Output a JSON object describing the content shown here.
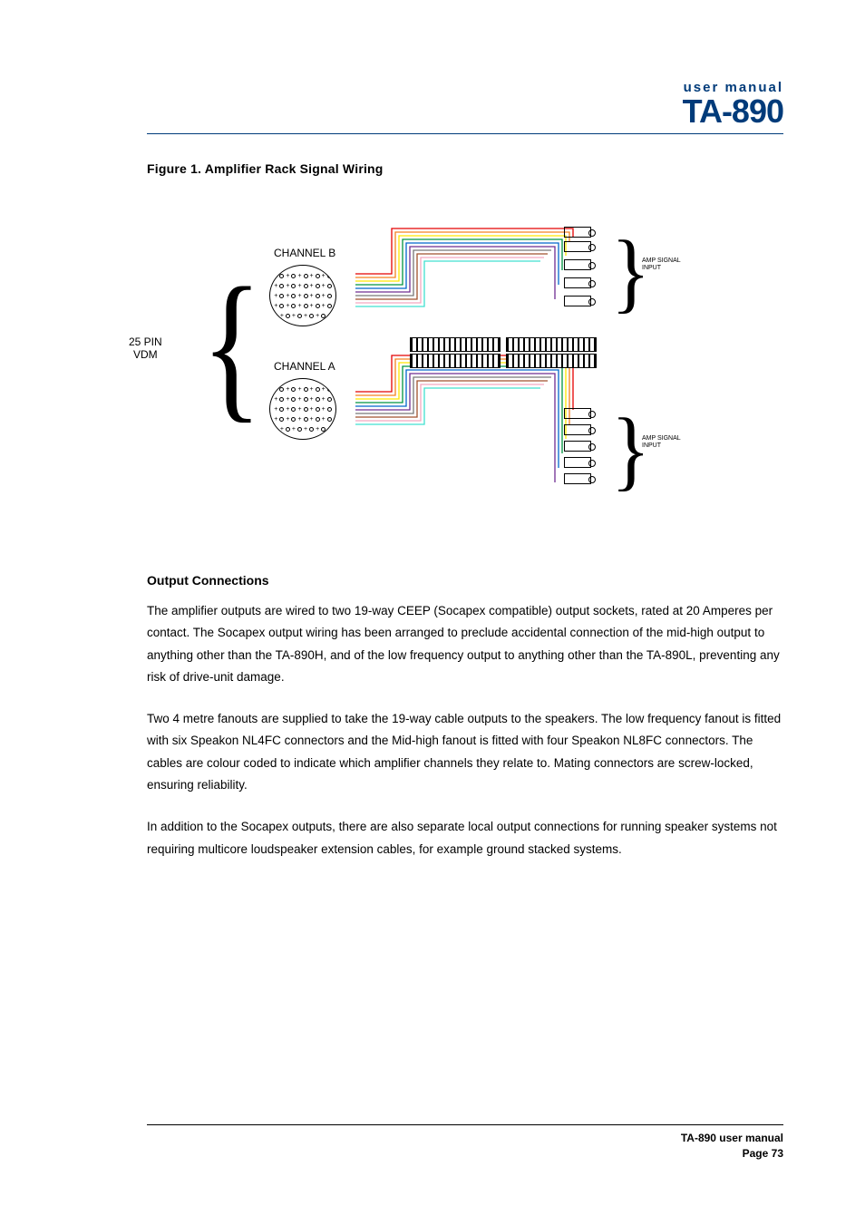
{
  "header": {
    "line1": "user manual",
    "model": "TA-890"
  },
  "figure": {
    "caption": "Figure 1. Amplifier Rack Signal Wiring",
    "left_label_line1": "25 PIN",
    "left_label_line2": "VDM",
    "channel_b": "CHANNEL B",
    "channel_a": "CHANNEL A",
    "amp_signal_input": "AMP SIGNAL",
    "amp_signal_input2": "INPUT"
  },
  "section": {
    "heading": "Output Connections",
    "p1": "The amplifier outputs are wired to two 19-way CEEP (Socapex compatible) output sockets, rated at 20 Amperes per contact. The Socapex output wiring has been arranged to preclude accidental connection of the mid-high output to anything other than the TA-890H, and of the low frequency output to anything other than the TA-890L, preventing any risk of drive-unit damage.",
    "p2": "Two 4 metre fanouts are supplied to take the 19-way cable outputs to the speakers. The low frequency fanout is fitted with six Speakon NL4FC connectors and the Mid-high fanout is fitted with four Speakon NL8FC connectors. The cables are colour coded to indicate which amplifier channels they relate to. Mating connectors are screw-locked, ensuring reliability.",
    "p3": "In addition to the Socapex outputs, there are also separate local output connections for running speaker systems not requiring multicore loudspeaker extension cables, for example ground stacked systems."
  },
  "footer": {
    "line1": "TA-890 user manual",
    "line2": "Page 73"
  },
  "wiring_colors": [
    "#e40000",
    "#f58220",
    "#ffe600",
    "#009440",
    "#0066cc",
    "#6f2c91",
    "#555555",
    "#a0522d",
    "#f4a7c0",
    "#40e0d0"
  ]
}
